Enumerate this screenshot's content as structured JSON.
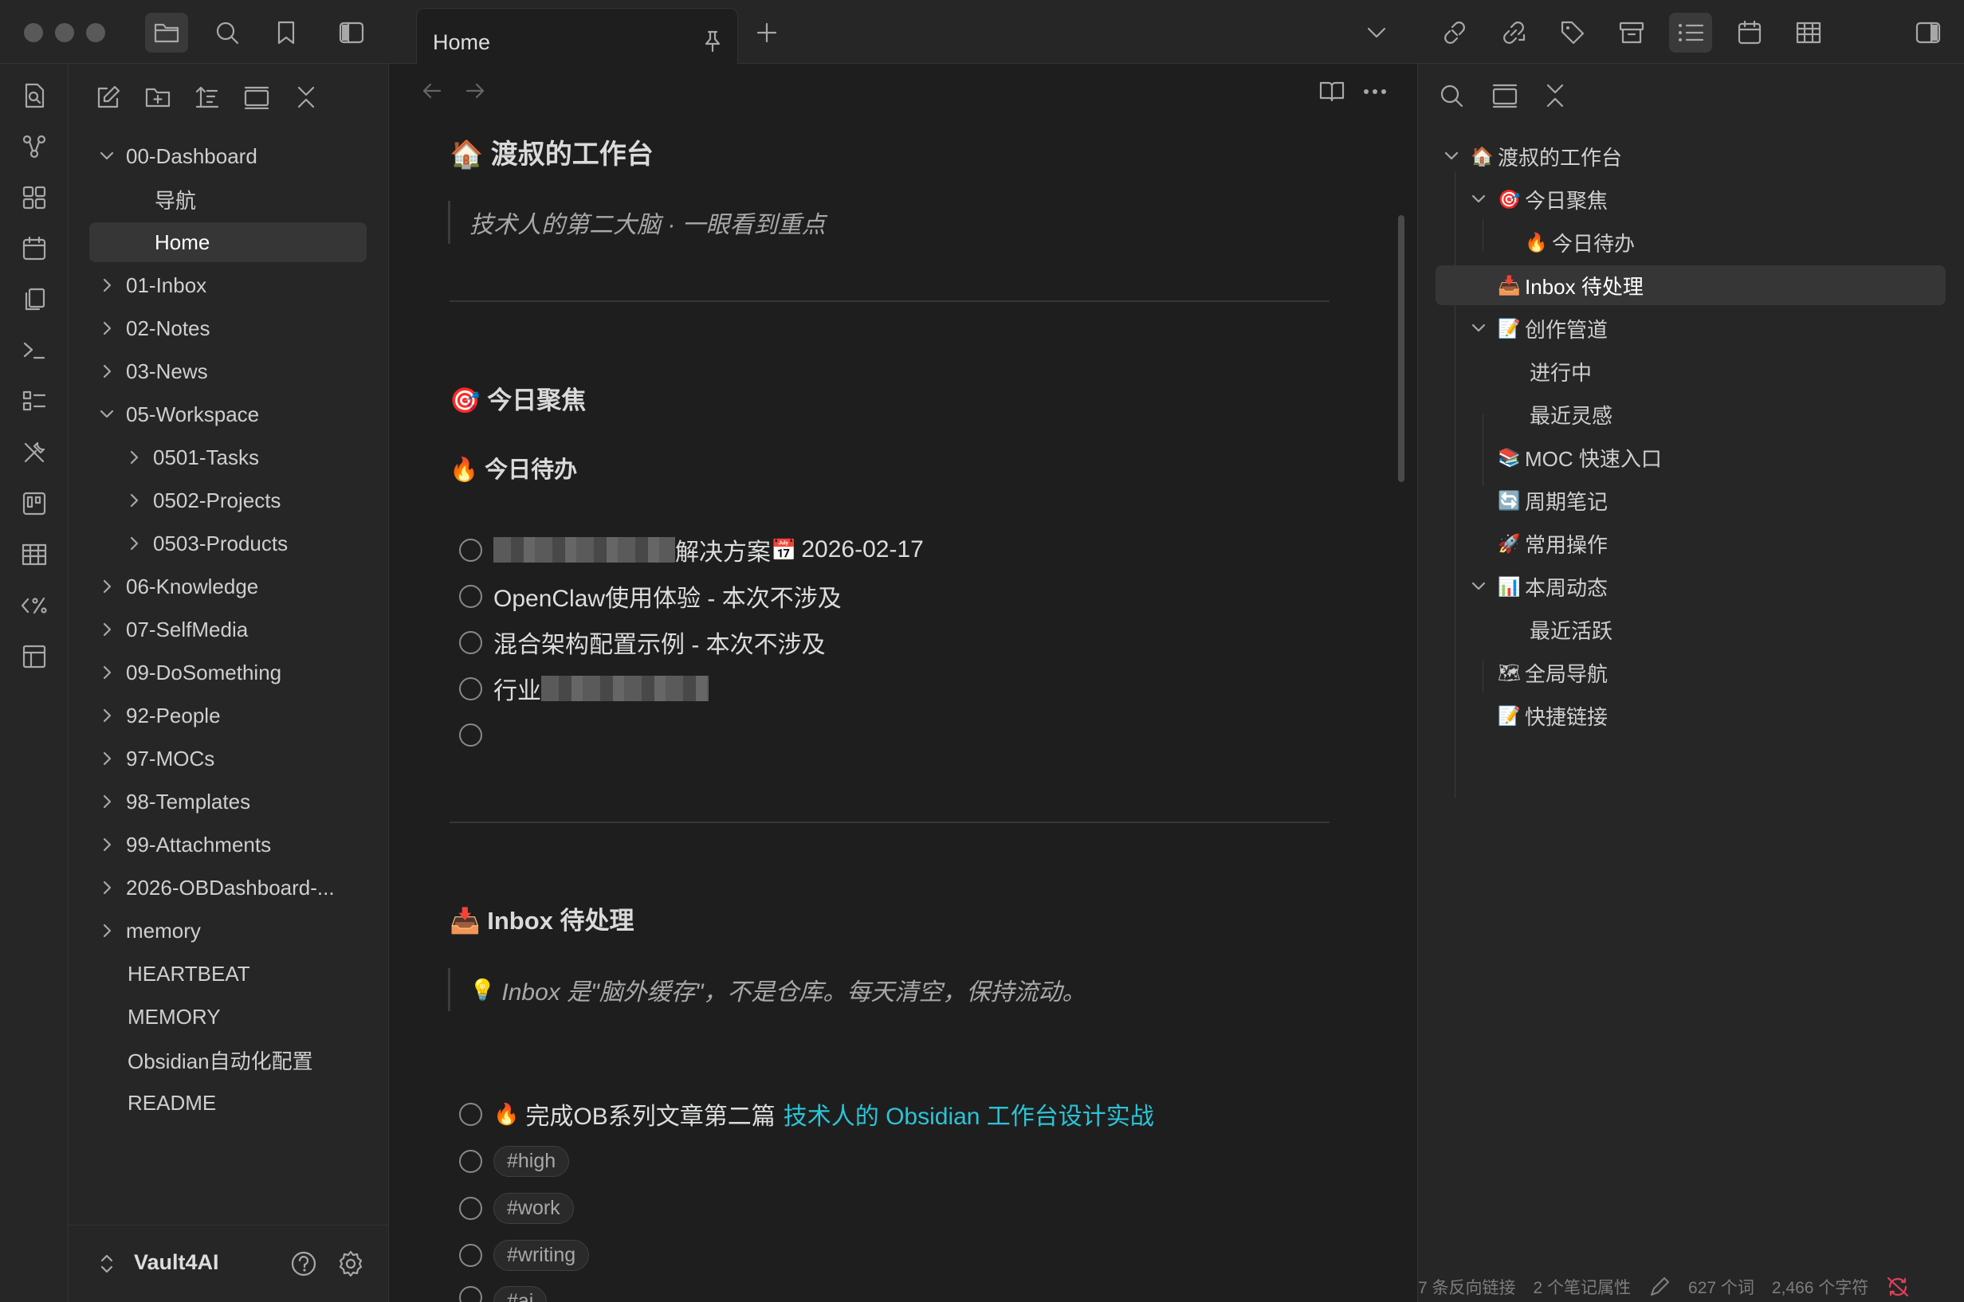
{
  "tabs": [
    {
      "label": "Home"
    }
  ],
  "explorer": {
    "items": [
      {
        "label": "00-Dashboard",
        "expanded": true
      },
      {
        "label": "导航"
      },
      {
        "label": "Home",
        "selected": true
      },
      {
        "label": "01-Inbox"
      },
      {
        "label": "02-Notes"
      },
      {
        "label": "03-News"
      },
      {
        "label": "05-Workspace",
        "expanded": true
      },
      {
        "label": "0501-Tasks"
      },
      {
        "label": "0502-Projects"
      },
      {
        "label": "0503-Products"
      },
      {
        "label": "06-Knowledge"
      },
      {
        "label": "07-SelfMedia"
      },
      {
        "label": "09-DoSomething"
      },
      {
        "label": "92-People"
      },
      {
        "label": "97-MOCs"
      },
      {
        "label": "98-Templates"
      },
      {
        "label": "99-Attachments"
      },
      {
        "label": "2026-OBDashboard-..."
      },
      {
        "label": "memory"
      },
      {
        "label": "HEARTBEAT"
      },
      {
        "label": "MEMORY"
      },
      {
        "label": "Obsidian自动化配置"
      },
      {
        "label": "README"
      }
    ],
    "vault_name": "Vault4AI"
  },
  "editor": {
    "title": "渡叔的工作台",
    "subtitle": "技术人的第二大脑 · 一眼看到重点",
    "focus_heading": "今日聚焦",
    "todo_heading": "今日待办",
    "todos": [
      {
        "text": "解决方案",
        "date": "2026-02-17",
        "date_icon": "calendar-emoji"
      },
      {
        "text": "OpenClaw使用体验 - 本次不涉及"
      },
      {
        "text": "混合架构配置示例 - 本次不涉及"
      },
      {
        "text": "行业"
      },
      {
        "text": ""
      }
    ],
    "inbox_heading": "Inbox 待处理",
    "inbox_quote": "Inbox 是\"脑外缓存\"，不是仓库。每天清空，保持流动。",
    "inbox_tasks": [
      {
        "prefix": "完成OB系列文章第二篇",
        "link": "技术人的 Obsidian 工作台设计实战"
      },
      {
        "tag": "#high"
      },
      {
        "tag": "#work"
      },
      {
        "tag": "#writing"
      },
      {
        "tag": "#ai"
      }
    ]
  },
  "outline": {
    "items": [
      {
        "label": "渡叔的工作台",
        "emoji": "🏠"
      },
      {
        "label": "今日聚焦",
        "emoji": "🎯"
      },
      {
        "label": "今日待办",
        "emoji": "🔥"
      },
      {
        "label": "Inbox 待处理",
        "emoji": "📥",
        "current": true
      },
      {
        "label": "创作管道",
        "emoji": "📝"
      },
      {
        "label": "进行中"
      },
      {
        "label": "最近灵感"
      },
      {
        "label": "MOC 快速入口",
        "emoji": "📚"
      },
      {
        "label": "周期笔记",
        "emoji": "🔄"
      },
      {
        "label": "常用操作",
        "emoji": "🚀"
      },
      {
        "label": "本周动态",
        "emoji": "📊"
      },
      {
        "label": "最近活跃"
      },
      {
        "label": "全局导航",
        "emoji": "🗺"
      },
      {
        "label": "快捷链接",
        "emoji": "📝"
      }
    ]
  },
  "status_bar": {
    "backlinks": "7 条反向链接",
    "properties": "2 个笔记属性",
    "words": "627 个词",
    "chars": "2,466 个字符"
  },
  "colors": {
    "accent": "#2bc4d7",
    "background": "#1e1e1e",
    "panel": "#262626"
  }
}
